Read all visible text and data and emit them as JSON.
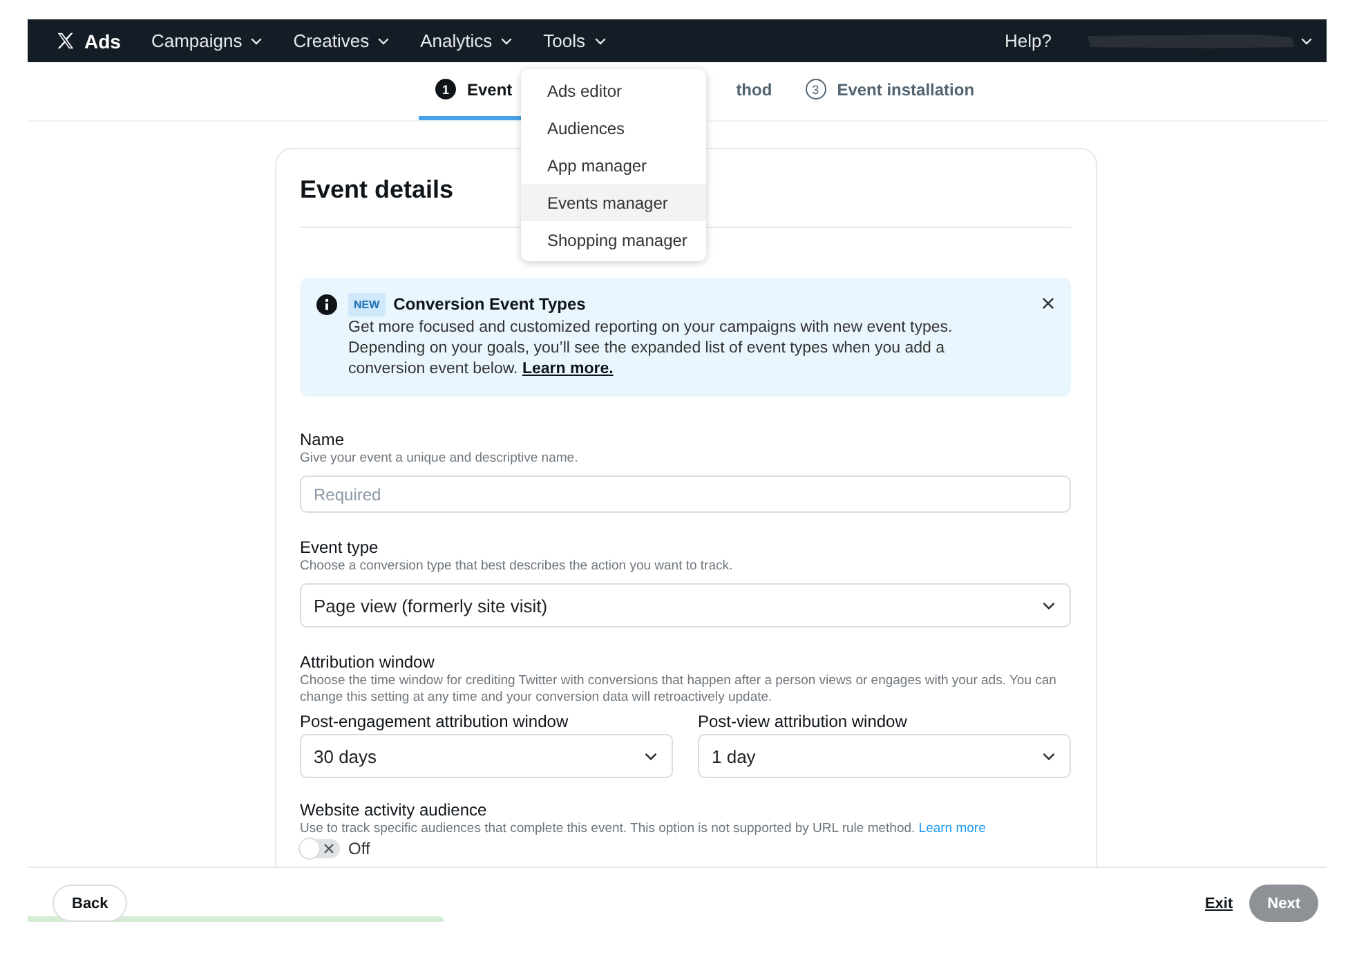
{
  "nav": {
    "logo": "Ads",
    "menus": [
      {
        "label": "Campaigns"
      },
      {
        "label": "Creatives"
      },
      {
        "label": "Analytics"
      },
      {
        "label": "Tools"
      }
    ],
    "help": "Help?"
  },
  "steps": [
    {
      "number": "1",
      "label": "Event",
      "selected": true
    },
    {
      "label": "thod",
      "selected": false
    },
    {
      "number": "3",
      "label": "Event installation",
      "selected": false
    }
  ],
  "tools_menu": [
    {
      "label": "Ads editor",
      "highlighted": false
    },
    {
      "label": "Audiences",
      "highlighted": false
    },
    {
      "label": "App manager",
      "highlighted": false
    },
    {
      "label": "Events manager",
      "highlighted": true
    },
    {
      "label": "Shopping manager",
      "highlighted": false
    }
  ],
  "card": {
    "title": "Event details",
    "alert": {
      "badge": "NEW",
      "title": "Conversion Event Types",
      "text": "Get more focused and customized reporting on your campaigns with new event types. Depending on your goals, you’ll see the expanded list of event types when you add a conversion event below.",
      "link": "Learn more."
    },
    "name": {
      "label": "Name",
      "hint": "Give your event a unique and descriptive name.",
      "placeholder": "Required"
    },
    "event_type": {
      "label": "Event type",
      "hint": "Choose a conversion type that best describes the action you want to track.",
      "value": "Page view (formerly site visit)"
    },
    "attribution": {
      "label": "Attribution window",
      "hint": "Choose the time window for crediting Twitter with conversions that happen after a person views or engages with your ads. You can change this setting at any time and your conversion data will retroactively update.",
      "selects": [
        {
          "label": "Post-engagement attribution window",
          "value": "30 days"
        },
        {
          "label": "Post-view attribution window",
          "value": "1 day"
        }
      ]
    },
    "audience": {
      "label": "Website activity audience",
      "hint": "Use to track specific audiences that complete this event. This option is not supported by URL rule method.",
      "link": "Learn more",
      "on": false,
      "state_label": "Off"
    }
  },
  "footer": {
    "back": "Back",
    "exit": "Exit",
    "next": "Next",
    "next_disabled": true,
    "progress": {
      "level": 0.32
    }
  }
}
